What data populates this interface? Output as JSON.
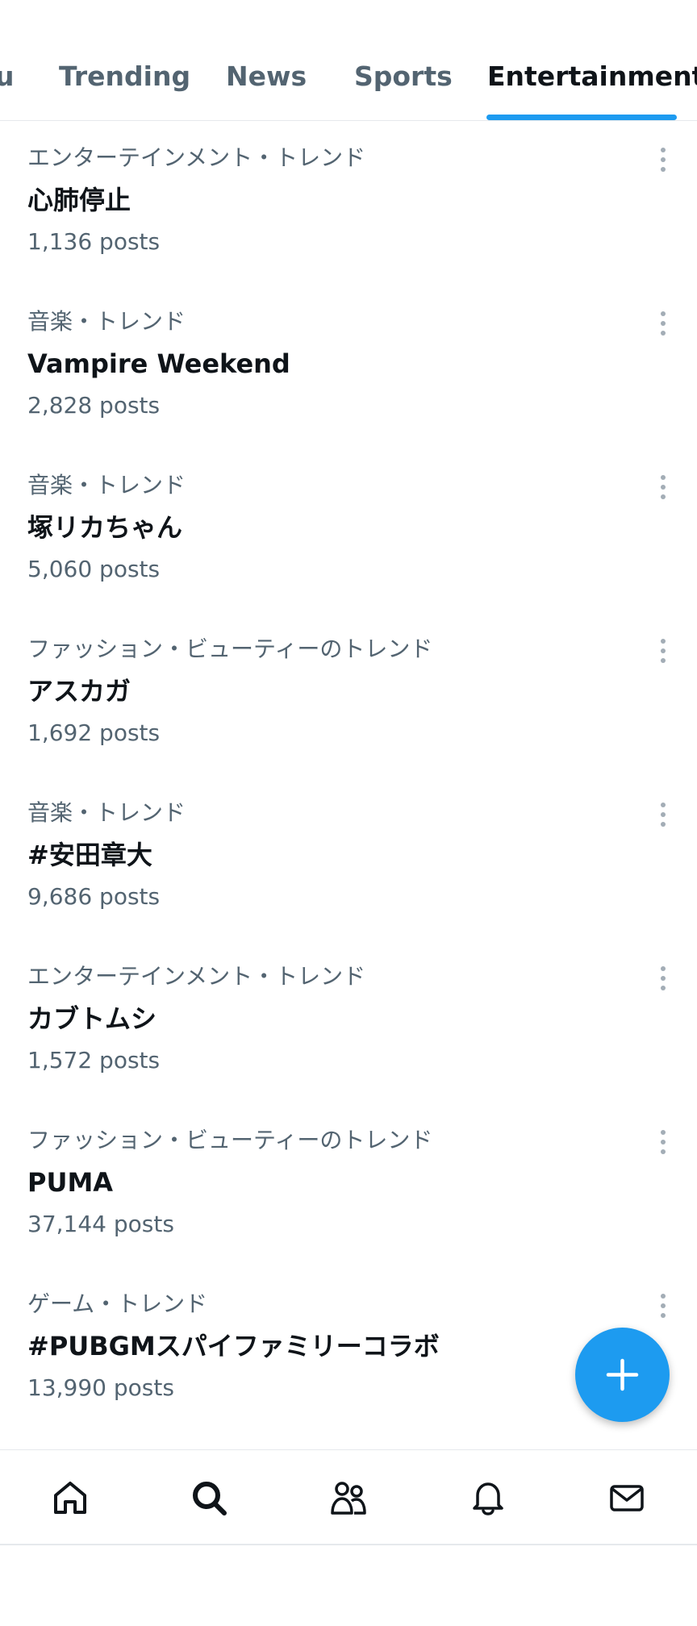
{
  "tabs": [
    {
      "label": "u"
    },
    {
      "label": "Trending"
    },
    {
      "label": "News"
    },
    {
      "label": "Sports"
    },
    {
      "label": "Entertainment",
      "active": true
    }
  ],
  "trends": [
    {
      "category": "エンターテインメント・トレンド",
      "title": "心肺停止",
      "posts": "1,136 posts"
    },
    {
      "category": "音楽・トレンド",
      "title": "Vampire Weekend",
      "posts": "2,828 posts"
    },
    {
      "category": "音楽・トレンド",
      "title": "塚リカちゃん",
      "posts": "5,060 posts"
    },
    {
      "category": "ファッション・ビューティーのトレンド",
      "title": "アスカガ",
      "posts": "1,692 posts"
    },
    {
      "category": "音楽・トレンド",
      "title": "#安田章大",
      "posts": "9,686 posts"
    },
    {
      "category": "エンターテインメント・トレンド",
      "title": "カブトムシ",
      "posts": "1,572 posts"
    },
    {
      "category": "ファッション・ビューティーのトレンド",
      "title": "PUMA",
      "posts": "37,144 posts"
    },
    {
      "category": "ゲーム・トレンド",
      "title": "#PUBGMスパイファミリーコラボ",
      "posts": "13,990 posts"
    }
  ],
  "icons": {
    "more": "more-vertical-icon",
    "compose": "plus-icon",
    "nav": [
      "home-icon",
      "search-icon",
      "communities-icon",
      "notifications-icon",
      "messages-icon"
    ]
  },
  "colors": {
    "accent": "#1d9bf0",
    "text_primary": "#0f1419",
    "text_secondary": "#536471",
    "divider": "#e6e9ec"
  }
}
